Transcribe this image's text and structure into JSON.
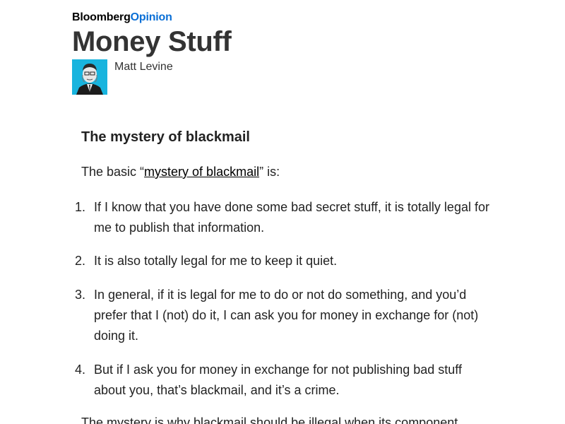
{
  "masthead": {
    "brand_primary": "Bloomberg",
    "brand_secondary": "Opinion",
    "title": "Money Stuff"
  },
  "byline": {
    "author": "Matt Levine"
  },
  "article": {
    "heading": "The mystery of blackmail",
    "intro_before": "The basic “",
    "intro_link": "mystery of blackmail",
    "intro_after": "” is:",
    "items": [
      {
        "num": "1.",
        "text": "If I know that you have done some bad secret stuff, it is totally legal for me to publish that information."
      },
      {
        "num": "2.",
        "text": "It is also totally legal for me to keep it quiet."
      },
      {
        "num": "3.",
        "text": "In general, if it is legal for me to do or not do something, and you’d prefer that I (not) do it, I can ask you for money in exchange for (not) doing it."
      },
      {
        "num": "4.",
        "text": "But if I ask you for money in exchange for not publishing bad stuff about you, that’s blackmail, and it’s a crime."
      }
    ],
    "trailing": "The mystery is why blackmail should be illegal when its component"
  },
  "colors": {
    "brand_accent": "#0a6fd6",
    "avatar_bg": "#18b4de"
  }
}
